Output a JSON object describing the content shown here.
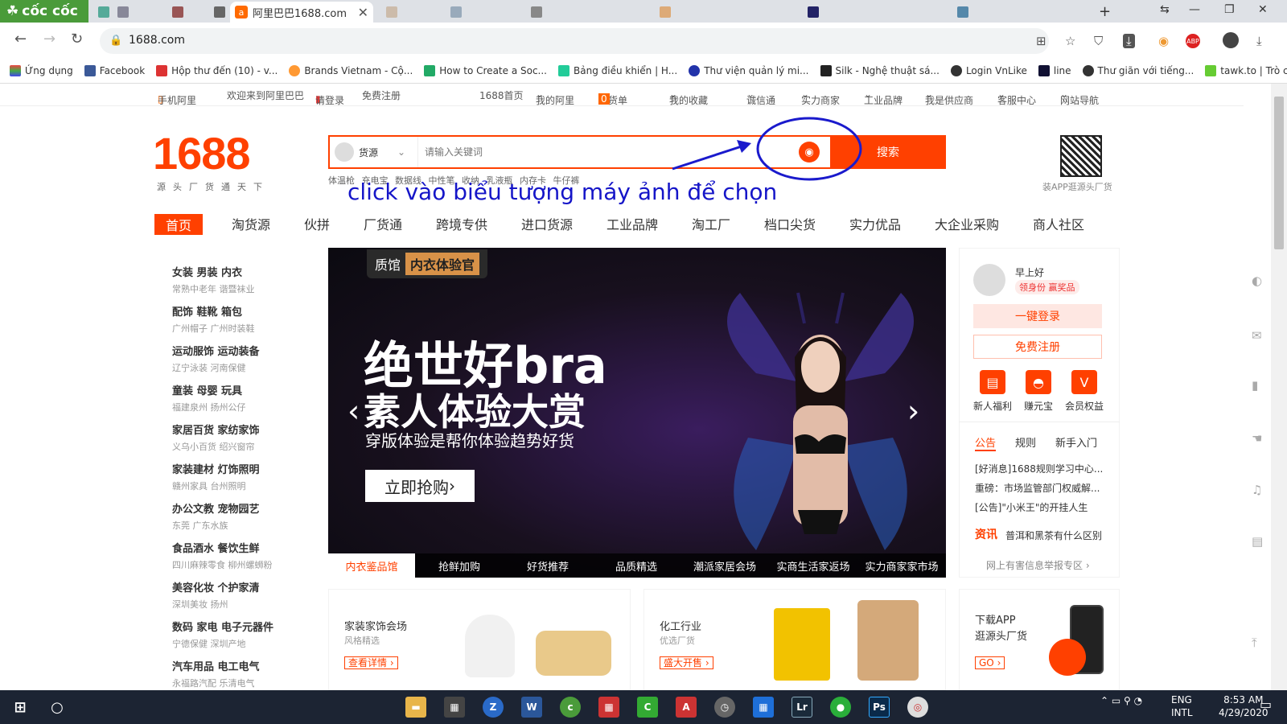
{
  "browser": {
    "brand": "cốc cốc",
    "active_tab_title": "阿里巴巴1688.com",
    "url": "1688.com",
    "bookmarks": [
      "Ứng dụng",
      "Facebook",
      "Hộp thư đến (10) - v...",
      "Brands Vietnam - Cộ...",
      "How to Create a Soc...",
      "Bảng điều khiển | H...",
      "Thư viện quản lý mi...",
      "Silk - Nghệ thuật sá...",
      "Login VnLike",
      "line",
      "Thư giãn với tiếng...",
      "tawk.to | Trò chuyện"
    ]
  },
  "topbar": {
    "mobile": "手机阿里",
    "welcome": "欢迎来到阿里巴巴",
    "login": "请登录",
    "register": "免费注册",
    "links": [
      "1688首页",
      "我的阿里",
      "进货单",
      "我的收藏",
      "诚信通",
      "实力商家",
      "工业品牌",
      "我是供应商",
      "客服中心",
      "网站导航"
    ],
    "cart_count": "0"
  },
  "logo": {
    "text": "1688",
    "slogan": "源头厂货通天下"
  },
  "search": {
    "category": "货源",
    "placeholder": "请输入关键词",
    "button": "搜索",
    "hotwords": "体温枪 充电宝 数据线 中性笔 收纳 乳液瓶 内存卡 牛仔裤"
  },
  "annotation": "click vào biểu tượng máy ảnh để chọn",
  "qr_caption": "装APP逛源头厂货",
  "nav": [
    "首页",
    "淘货源",
    "伙拼",
    "厂货通",
    "跨境专供",
    "进口货源",
    "工业品牌",
    "淘工厂",
    "档口尖货",
    "实力优品",
    "大企业采购",
    "商人社区"
  ],
  "categories": [
    {
      "main": "女装 男装 内衣",
      "sub": "常熟中老年 谐暨袜业"
    },
    {
      "main": "配饰 鞋靴 箱包",
      "sub": "广州帽子 广州时装鞋"
    },
    {
      "main": "运动服饰 运动装备",
      "sub": "辽宁泳装 河南保健"
    },
    {
      "main": "童装 母婴 玩具",
      "sub": "福建泉州 扬州公仔"
    },
    {
      "main": "家居百货 家纺家饰",
      "sub": "义乌小百货 绍兴窗帘"
    },
    {
      "main": "家装建材 灯饰照明",
      "sub": "赣州家具 台州照明"
    },
    {
      "main": "办公文教 宠物园艺",
      "sub": "东莞 广东水族"
    },
    {
      "main": "食品酒水 餐饮生鲜",
      "sub": "四川麻辣零食 柳州螺蛳粉"
    },
    {
      "main": "美容化妆 个护家清",
      "sub": "深圳美妆 扬州"
    },
    {
      "main": "数码 家电 电子元器件",
      "sub": "宁德保健 深圳产地"
    },
    {
      "main": "汽车用品 电工电气",
      "sub": "永福路汽配 乐清电气"
    }
  ],
  "banner": {
    "badge_left": "质馆",
    "badge_right": "内衣体验官",
    "headline1": "绝世好bra",
    "headline2": "素人体验大赏",
    "subline": "穿版体验是帮你体验趋势好货",
    "cta": "立即抢购",
    "tabs": [
      "内衣鉴品馆",
      "抢鲜加购",
      "好货推荐",
      "品质精选",
      "潮派家居会场",
      "实商生活家返场",
      "实力商家家市场"
    ]
  },
  "user_panel": {
    "greeting": "早上好",
    "prize": "领身份 赢奖品",
    "login": "一键登录",
    "register": "免费注册",
    "shortcuts": [
      "新人福利",
      "赚元宝",
      "会员权益"
    ],
    "news_tabs": [
      "公告",
      "规则",
      "新手入门"
    ],
    "news": [
      "[好消息]1688规则学习中心...",
      "重磅：市场监管部门权威解...",
      "[公告]\"小米王\"的开挂人生"
    ],
    "zixun_label": "资讯",
    "zixun_text": "普洱和黑茶有什么区别",
    "report": "网上有害信息举报专区"
  },
  "cards": [
    {
      "title": "家装家饰会场",
      "sub": "风格精选",
      "btn": "查看详情"
    },
    {
      "title": "化工行业",
      "sub": "优选厂货",
      "btn": "盛大开售"
    },
    {
      "title": "下载APP",
      "sub": "逛源头厂货",
      "btn": "GO"
    }
  ],
  "taskbar": {
    "lang": "ENG",
    "layout": "INTL",
    "time": "8:53 AM",
    "date": "4/29/2020"
  },
  "colors": {
    "brand": "#ff4000",
    "annotation": "#1515c8"
  }
}
